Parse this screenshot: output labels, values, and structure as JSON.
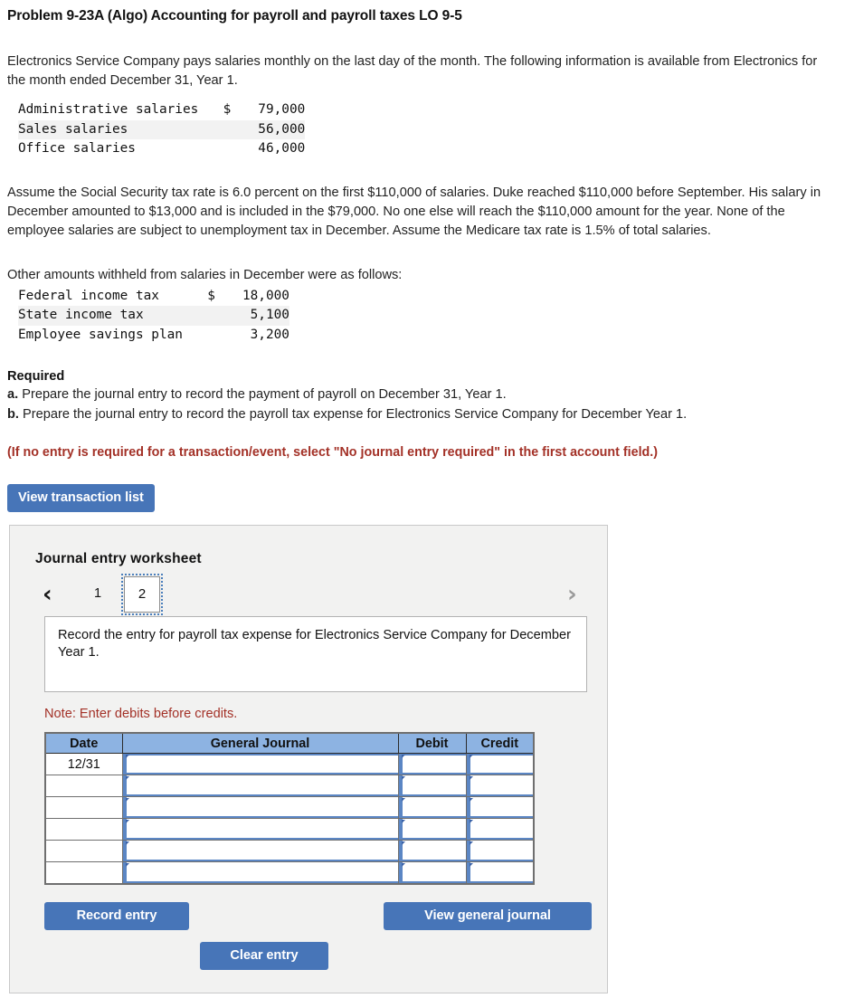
{
  "problem": {
    "title": "Problem 9-23A (Algo) Accounting for payroll and payroll taxes LO 9-5",
    "intro": "Electronics Service Company pays salaries monthly on the last day of the month. The following information is available from Electronics for the month ended December 31, Year 1.",
    "assumption": "Assume the Social Security tax rate is 6.0 percent on the first $110,000 of salaries. Duke reached $110,000 before September. His salary in December amounted to $13,000 and is included in the $79,000. No one else will reach the $110,000 amount for the year. None of the employee salaries are subject to unemployment tax in December. Assume the Medicare tax rate is 1.5% of total salaries.",
    "other_intro": "Other amounts withheld from salaries in December were as follows:"
  },
  "salaries": [
    {
      "label": "Administrative salaries",
      "currency": "$",
      "amount": "79,000"
    },
    {
      "label": "Sales salaries",
      "currency": "",
      "amount": "56,000"
    },
    {
      "label": "Office salaries",
      "currency": "",
      "amount": "46,000"
    }
  ],
  "withholdings": [
    {
      "label": "Federal income tax",
      "currency": "$",
      "amount": "18,000"
    },
    {
      "label": "State income tax",
      "currency": "",
      "amount": "5,100"
    },
    {
      "label": "Employee savings plan",
      "currency": "",
      "amount": "3,200"
    }
  ],
  "required": {
    "heading": "Required",
    "item_a_marker": "a.",
    "item_a": "Prepare the journal entry to record the payment of payroll on December 31, Year 1.",
    "item_b_marker": "b.",
    "item_b": "Prepare the journal entry to record the payroll tax expense for Electronics Service Company for December Year 1.",
    "red_note": "(If no entry is required for a transaction/event, select \"No journal entry required\" in the first account field.)"
  },
  "toolbar": {
    "view_transaction_list": "View transaction list"
  },
  "worksheet": {
    "title": "Journal entry worksheet",
    "pager": {
      "prev_icon": "chevron-left",
      "prev_glyph": "‹",
      "next_icon": "chevron-right",
      "next_glyph": "›",
      "pages": [
        "1",
        "2"
      ],
      "selected_page": "2"
    },
    "prompt": "Record the entry for payroll tax expense for Electronics Service Company for December Year 1.",
    "note": "Note: Enter debits before credits.",
    "table": {
      "columns": [
        "Date",
        "General Journal",
        "Debit",
        "Credit"
      ],
      "rows": [
        {
          "date": "12/31",
          "general_journal": "",
          "debit": "",
          "credit": ""
        },
        {
          "date": "",
          "general_journal": "",
          "debit": "",
          "credit": ""
        },
        {
          "date": "",
          "general_journal": "",
          "debit": "",
          "credit": ""
        },
        {
          "date": "",
          "general_journal": "",
          "debit": "",
          "credit": ""
        },
        {
          "date": "",
          "general_journal": "",
          "debit": "",
          "credit": ""
        },
        {
          "date": "",
          "general_journal": "",
          "debit": "",
          "credit": ""
        }
      ]
    },
    "buttons": {
      "record_entry": "Record entry",
      "clear_entry": "Clear entry",
      "view_general_journal": "View general journal"
    }
  },
  "colors": {
    "button_blue": "#4775b8",
    "table_header_blue": "#8db3e2",
    "note_red": "#a33127",
    "panel_gray": "#f2f2f1",
    "cell_rail_blue": "#5b86c4"
  }
}
